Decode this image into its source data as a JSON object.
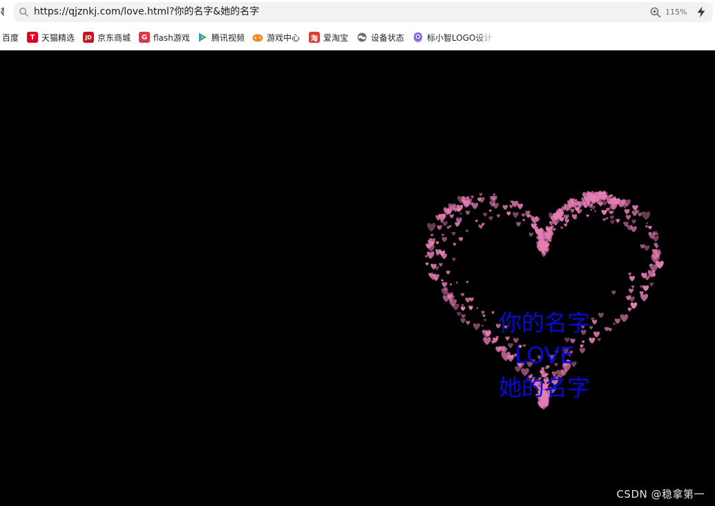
{
  "browser": {
    "left_edge_glyph": "む",
    "url": "https://qjznkj.com/love.html?你的名字&她的名字",
    "zoom": "115%",
    "bookmarks": [
      {
        "label": "百度",
        "icon": "baidu-icon"
      },
      {
        "label": "天猫精选",
        "icon": "tmall-icon",
        "glyph": "T",
        "color": "#e1001e"
      },
      {
        "label": "京东商城",
        "icon": "jd-icon",
        "glyph": "JD",
        "color": "#c8161d"
      },
      {
        "label": "flash游戏",
        "icon": "flash-game-icon",
        "glyph": "G",
        "color": "#e2334a"
      },
      {
        "label": "腾讯视频",
        "icon": "tencent-video-icon"
      },
      {
        "label": "游戏中心",
        "icon": "game-center-icon"
      },
      {
        "label": "爱淘宝",
        "icon": "aitaobao-icon",
        "glyph": "淘",
        "color": "#e03b2e"
      },
      {
        "label": "设备状态",
        "icon": "device-status-icon"
      },
      {
        "label": "标小智LOGO设计",
        "icon": "biaoxiaozhi-icon"
      }
    ]
  },
  "page": {
    "line1": "你的名字",
    "line2": "LOVE",
    "line3": "她的名字",
    "watermark": "CSDN @稳拿第一",
    "heart_color": "#e57cb5",
    "text_color": "#0a0ad6"
  }
}
